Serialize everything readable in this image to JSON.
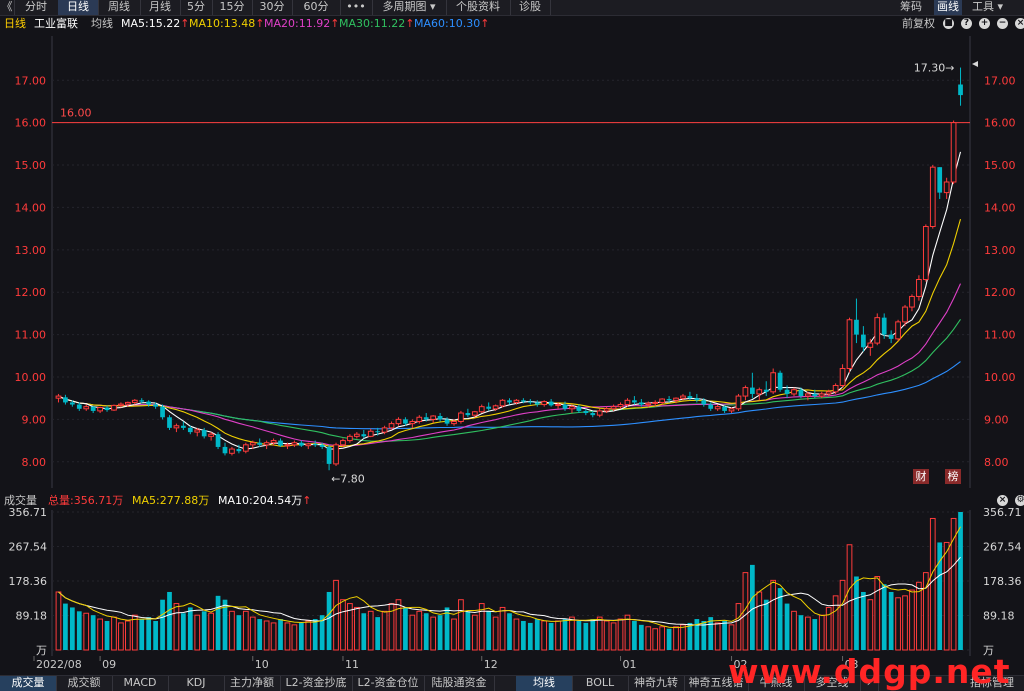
{
  "toolbar": {
    "back_glyph": "《",
    "tabs": [
      "分时",
      "日线",
      "周线",
      "月线",
      "5分",
      "15分",
      "30分",
      "60分",
      "•••",
      "多周期图 ▾",
      "个股资料",
      "诊股"
    ],
    "active_tab": "日线",
    "right_items": [
      "筹码",
      "画线",
      "工具 ▾"
    ]
  },
  "infobar": {
    "period": "日线",
    "stock_name": "工业富联",
    "ma_label": "均线",
    "ma5": "MA5:15.22",
    "ma10": "MA10:13.48",
    "ma20": "MA20:11.92",
    "ma30": "MA30:11.22",
    "ma60": "MA60:10.30",
    "adjust": "前复权",
    "arrow_up": "↑"
  },
  "price_chart": {
    "y_ticks": [
      "17.00",
      "16.00",
      "15.00",
      "14.00",
      "13.00",
      "12.00",
      "11.00",
      "10.00",
      "9.00",
      "8.00"
    ],
    "y_values": [
      17,
      16,
      15,
      14,
      13,
      12,
      11,
      10,
      9,
      8
    ],
    "ylim": [
      7.57,
      17.95
    ],
    "ref_line_label": "16.00",
    "ref_line_value": 16.0,
    "high_label": "17.30→",
    "low_label": "←7.80",
    "badges": [
      "财",
      "榜"
    ]
  },
  "volume_header": {
    "title": "成交量",
    "total": "总量:356.71万",
    "ma5": "MA5:277.88万",
    "ma10": "MA10:204.54万",
    "arrow_up": "↑"
  },
  "volume_chart": {
    "y_ticks": [
      "356.71",
      "267.54",
      "178.36",
      "89.18",
      "万"
    ],
    "y_values": [
      356.71,
      267.54,
      178.36,
      89.18,
      0
    ],
    "ylim": [
      0,
      356.71
    ],
    "x_labels": [
      "2022/08",
      "09",
      "10",
      "11",
      "12",
      "01",
      "02",
      "03"
    ]
  },
  "bottombar": {
    "tabs": [
      "成交量",
      "成交额",
      "MACD",
      "KDJ",
      "主力净额",
      "L2-资金抄底",
      "L2-资金仓位",
      "陆股通资金",
      "均线",
      "BOLL",
      "神奇九转",
      "神奇五线谱",
      "牛熊线",
      "多空线",
      "›",
      "指标管理"
    ],
    "active_tabs": [
      "成交量",
      "均线"
    ]
  },
  "watermark": "www.ddgp.net",
  "colors": {
    "up": "#ff3b3b",
    "down": "#00b8c8",
    "ma5": "#ffffff",
    "ma10": "#f0d000",
    "ma20": "#e040c8",
    "ma30": "#30c060",
    "ma60": "#2d8fff",
    "ref_line": "#ff4040"
  },
  "chart_data": {
    "type": "candlestick",
    "x_label_positions": {
      "2022/08": 0,
      "09": 6,
      "10": 28,
      "11": 41,
      "12": 61,
      "01": 81,
      "02": 97,
      "03": 113
    },
    "ohlc": [
      [
        9.5,
        9.6,
        9.4,
        9.55,
        150
      ],
      [
        9.52,
        9.58,
        9.35,
        9.4,
        120
      ],
      [
        9.4,
        9.45,
        9.3,
        9.35,
        110
      ],
      [
        9.35,
        9.4,
        9.2,
        9.25,
        100
      ],
      [
        9.25,
        9.35,
        9.2,
        9.3,
        95
      ],
      [
        9.3,
        9.32,
        9.15,
        9.2,
        90
      ],
      [
        9.2,
        9.3,
        9.15,
        9.28,
        80
      ],
      [
        9.28,
        9.32,
        9.18,
        9.22,
        75
      ],
      [
        9.22,
        9.35,
        9.2,
        9.33,
        85
      ],
      [
        9.33,
        9.4,
        9.28,
        9.36,
        70
      ],
      [
        9.36,
        9.42,
        9.3,
        9.4,
        75
      ],
      [
        9.4,
        9.48,
        9.35,
        9.45,
        90
      ],
      [
        9.45,
        9.5,
        9.38,
        9.42,
        80
      ],
      [
        9.42,
        9.45,
        9.3,
        9.35,
        85
      ],
      [
        9.35,
        9.4,
        9.25,
        9.3,
        75
      ],
      [
        9.3,
        9.35,
        9.0,
        9.05,
        130
      ],
      [
        9.05,
        9.1,
        8.75,
        8.8,
        150
      ],
      [
        8.8,
        8.9,
        8.7,
        8.85,
        120
      ],
      [
        8.85,
        8.95,
        8.75,
        8.8,
        95
      ],
      [
        8.8,
        8.85,
        8.65,
        8.7,
        110
      ],
      [
        8.7,
        8.8,
        8.6,
        8.75,
        90
      ],
      [
        8.75,
        8.8,
        8.55,
        8.6,
        100
      ],
      [
        8.6,
        8.7,
        8.5,
        8.65,
        95
      ],
      [
        8.65,
        8.7,
        8.3,
        8.35,
        140
      ],
      [
        8.35,
        8.45,
        8.15,
        8.2,
        130
      ],
      [
        8.2,
        8.35,
        8.15,
        8.3,
        100
      ],
      [
        8.3,
        8.4,
        8.2,
        8.25,
        90
      ],
      [
        8.25,
        8.45,
        8.2,
        8.4,
        100
      ],
      [
        8.4,
        8.5,
        8.3,
        8.45,
        85
      ],
      [
        8.45,
        8.55,
        8.35,
        8.4,
        80
      ],
      [
        8.4,
        8.5,
        8.3,
        8.45,
        75
      ],
      [
        8.45,
        8.55,
        8.38,
        8.5,
        70
      ],
      [
        8.5,
        8.55,
        8.35,
        8.38,
        80
      ],
      [
        8.38,
        8.45,
        8.3,
        8.4,
        70
      ],
      [
        8.4,
        8.5,
        8.35,
        8.45,
        65
      ],
      [
        8.45,
        8.5,
        8.35,
        8.38,
        70
      ],
      [
        8.38,
        8.45,
        8.3,
        8.42,
        75
      ],
      [
        8.42,
        8.5,
        8.35,
        8.4,
        80
      ],
      [
        8.4,
        8.45,
        8.3,
        8.35,
        90
      ],
      [
        8.35,
        8.4,
        7.8,
        7.95,
        150
      ],
      [
        7.95,
        8.45,
        7.9,
        8.4,
        180
      ],
      [
        8.4,
        8.55,
        8.35,
        8.5,
        130
      ],
      [
        8.5,
        8.65,
        8.45,
        8.6,
        120
      ],
      [
        8.6,
        8.7,
        8.55,
        8.65,
        110
      ],
      [
        8.65,
        8.75,
        8.55,
        8.6,
        95
      ],
      [
        8.6,
        8.78,
        8.58,
        8.72,
        100
      ],
      [
        8.72,
        8.8,
        8.62,
        8.7,
        85
      ],
      [
        8.7,
        8.85,
        8.65,
        8.8,
        100
      ],
      [
        8.8,
        8.95,
        8.75,
        8.9,
        120
      ],
      [
        8.9,
        9.05,
        8.85,
        9.0,
        130
      ],
      [
        9.0,
        9.05,
        8.85,
        8.9,
        110
      ],
      [
        8.9,
        9.0,
        8.8,
        8.95,
        90
      ],
      [
        8.95,
        9.1,
        8.9,
        9.05,
        100
      ],
      [
        9.05,
        9.15,
        8.95,
        9.0,
        95
      ],
      [
        9.0,
        9.1,
        8.92,
        9.08,
        85
      ],
      [
        9.08,
        9.15,
        8.95,
        9.0,
        90
      ],
      [
        9.0,
        9.05,
        8.85,
        8.9,
        110
      ],
      [
        8.9,
        9.0,
        8.85,
        8.95,
        80
      ],
      [
        8.95,
        9.2,
        8.9,
        9.15,
        130
      ],
      [
        9.15,
        9.25,
        9.05,
        9.1,
        100
      ],
      [
        9.1,
        9.2,
        9.05,
        9.18,
        90
      ],
      [
        9.18,
        9.35,
        9.15,
        9.3,
        120
      ],
      [
        9.3,
        9.4,
        9.2,
        9.25,
        100
      ],
      [
        9.25,
        9.35,
        9.2,
        9.32,
        85
      ],
      [
        9.32,
        9.48,
        9.28,
        9.45,
        110
      ],
      [
        9.45,
        9.5,
        9.35,
        9.4,
        95
      ],
      [
        9.4,
        9.48,
        9.35,
        9.45,
        80
      ],
      [
        9.45,
        9.5,
        9.38,
        9.42,
        75
      ],
      [
        9.42,
        9.48,
        9.35,
        9.4,
        70
      ],
      [
        9.4,
        9.45,
        9.3,
        9.35,
        80
      ],
      [
        9.35,
        9.45,
        9.3,
        9.42,
        75
      ],
      [
        9.42,
        9.48,
        9.3,
        9.33,
        70
      ],
      [
        9.33,
        9.4,
        9.25,
        9.35,
        75
      ],
      [
        9.35,
        9.42,
        9.2,
        9.25,
        80
      ],
      [
        9.25,
        9.35,
        9.15,
        9.3,
        85
      ],
      [
        9.3,
        9.35,
        9.15,
        9.2,
        75
      ],
      [
        9.2,
        9.25,
        9.1,
        9.15,
        70
      ],
      [
        9.15,
        9.2,
        9.05,
        9.1,
        80
      ],
      [
        9.1,
        9.25,
        9.05,
        9.2,
        85
      ],
      [
        9.2,
        9.3,
        9.15,
        9.25,
        75
      ],
      [
        9.25,
        9.35,
        9.2,
        9.3,
        70
      ],
      [
        9.3,
        9.4,
        9.25,
        9.35,
        80
      ],
      [
        9.35,
        9.5,
        9.3,
        9.45,
        90
      ],
      [
        9.45,
        9.55,
        9.35,
        9.4,
        75
      ],
      [
        9.4,
        9.48,
        9.3,
        9.35,
        65
      ],
      [
        9.35,
        9.42,
        9.28,
        9.38,
        60
      ],
      [
        9.38,
        9.45,
        9.3,
        9.4,
        55
      ],
      [
        9.4,
        9.5,
        9.35,
        9.48,
        60
      ],
      [
        9.48,
        9.55,
        9.4,
        9.45,
        55
      ],
      [
        9.45,
        9.52,
        9.38,
        9.5,
        60
      ],
      [
        9.5,
        9.6,
        9.45,
        9.55,
        65
      ],
      [
        9.55,
        9.65,
        9.45,
        9.5,
        70
      ],
      [
        9.5,
        9.6,
        9.4,
        9.45,
        80
      ],
      [
        9.45,
        9.5,
        9.3,
        9.35,
        75
      ],
      [
        9.35,
        9.4,
        9.2,
        9.25,
        85
      ],
      [
        9.25,
        9.35,
        9.2,
        9.3,
        70
      ],
      [
        9.3,
        9.32,
        9.15,
        9.2,
        75
      ],
      [
        9.2,
        9.28,
        9.15,
        9.25,
        65
      ],
      [
        9.25,
        9.6,
        9.2,
        9.55,
        120
      ],
      [
        9.55,
        9.8,
        9.45,
        9.75,
        200
      ],
      [
        9.75,
        10.1,
        9.5,
        9.6,
        220
      ],
      [
        9.6,
        9.75,
        9.45,
        9.7,
        150
      ],
      [
        9.7,
        9.9,
        9.55,
        9.65,
        130
      ],
      [
        9.65,
        10.2,
        9.6,
        10.1,
        180
      ],
      [
        10.1,
        10.15,
        9.65,
        9.7,
        160
      ],
      [
        9.7,
        9.8,
        9.5,
        9.6,
        120
      ],
      [
        9.6,
        9.75,
        9.55,
        9.7,
        100
      ],
      [
        9.7,
        9.75,
        9.5,
        9.55,
        90
      ],
      [
        9.55,
        9.65,
        9.45,
        9.6,
        85
      ],
      [
        9.6,
        9.7,
        9.5,
        9.55,
        80
      ],
      [
        9.55,
        9.65,
        9.5,
        9.6,
        90
      ],
      [
        9.6,
        9.7,
        9.55,
        9.65,
        110
      ],
      [
        9.65,
        9.85,
        9.6,
        9.8,
        140
      ],
      [
        9.8,
        10.3,
        9.75,
        10.2,
        180
      ],
      [
        10.2,
        11.4,
        10.1,
        11.35,
        272
      ],
      [
        11.35,
        11.85,
        10.8,
        11.0,
        190
      ],
      [
        11.0,
        11.2,
        10.6,
        10.7,
        150
      ],
      [
        10.7,
        10.9,
        10.5,
        10.8,
        130
      ],
      [
        10.8,
        11.5,
        10.75,
        11.4,
        190
      ],
      [
        11.4,
        11.5,
        10.9,
        11.0,
        170
      ],
      [
        11.0,
        11.1,
        10.8,
        10.9,
        150
      ],
      [
        10.9,
        11.35,
        10.85,
        11.3,
        135
      ],
      [
        11.3,
        11.7,
        11.2,
        11.65,
        140
      ],
      [
        11.65,
        11.95,
        11.55,
        11.9,
        155
      ],
      [
        11.9,
        12.4,
        11.8,
        12.3,
        175
      ],
      [
        12.3,
        13.6,
        12.25,
        13.55,
        200
      ],
      [
        13.55,
        15.0,
        13.5,
        14.95,
        340
      ],
      [
        14.95,
        14.95,
        14.2,
        14.35,
        278
      ],
      [
        14.35,
        14.7,
        14.2,
        14.6,
        278
      ],
      [
        14.6,
        16.05,
        14.55,
        16.0,
        340
      ],
      [
        16.9,
        17.3,
        16.4,
        16.65,
        356.71
      ]
    ]
  }
}
